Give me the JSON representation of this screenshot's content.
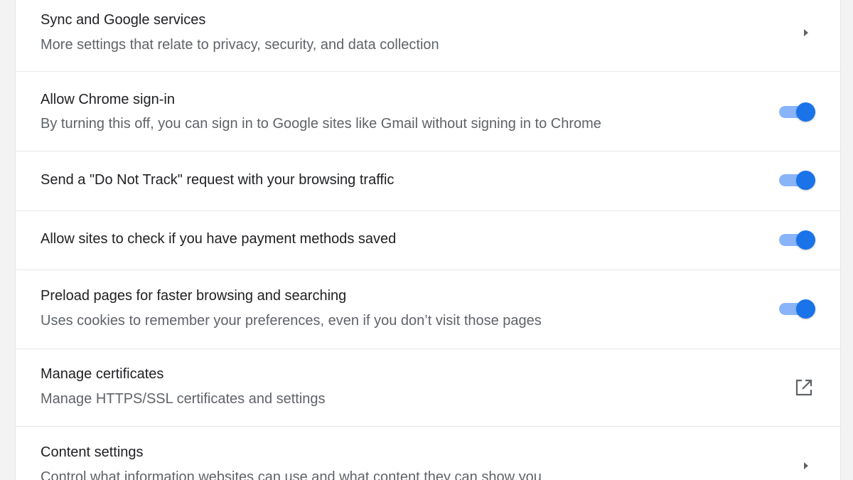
{
  "colors": {
    "toggle_track": "#8ab4f8",
    "toggle_knob": "#1a73e8",
    "title_text": "#202124",
    "subtitle_text": "#5f6368",
    "icon": "#5f6368"
  },
  "settings": [
    {
      "title": "Sync and Google services",
      "subtitle": "More settings that relate to privacy, security, and data collection",
      "control": "chevron-right-icon"
    },
    {
      "title": "Allow Chrome sign-in",
      "subtitle": "By turning this off, you can sign in to Google sites like Gmail without signing in to Chrome",
      "control": "toggle",
      "enabled": true
    },
    {
      "title": "Send a \"Do Not Track\" request with your browsing traffic",
      "control": "toggle",
      "enabled": true
    },
    {
      "title": "Allow sites to check if you have payment methods saved",
      "control": "toggle",
      "enabled": true
    },
    {
      "title": "Preload pages for faster browsing and searching",
      "subtitle": "Uses cookies to remember your preferences, even if you don’t visit those pages",
      "control": "toggle",
      "enabled": true
    },
    {
      "title": "Manage certificates",
      "subtitle": "Manage HTTPS/SSL certificates and settings",
      "control": "open-in-new-icon"
    },
    {
      "title": "Content settings",
      "subtitle": "Control what information websites can use and what content they can show you",
      "control": "chevron-right-icon"
    }
  ]
}
